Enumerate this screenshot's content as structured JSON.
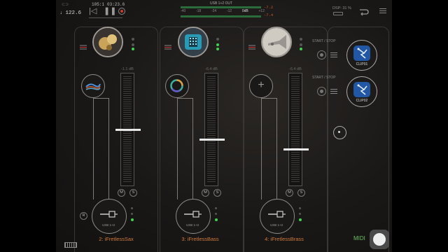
{
  "transport": {
    "position": "105:1",
    "time": "03:23.6",
    "tempo": "122.6",
    "tempo_icon": "metronome-note-icon"
  },
  "output": {
    "label": "USB 1+2 OUT",
    "scale": [
      "-40",
      "-18",
      "-24",
      "-12",
      "0dB",
      "+12"
    ],
    "peak_left": "-7.2",
    "peak_right": "-7.4",
    "readout": "0dB"
  },
  "dsp": {
    "label": "DSP: 31 %"
  },
  "channels": [
    {
      "name": "2: iFretlessSax",
      "db": "-1.1 dB",
      "output": "USB 1+2",
      "instrument": "saxophone",
      "fader_level": 0.5,
      "effect": "waves"
    },
    {
      "name": "3: iFretlessBass",
      "db": "-6.4 dB",
      "output": "USB 1+2",
      "instrument": "bass-app",
      "fader_level": 0.41,
      "effect": "ring"
    },
    {
      "name": "4: iFretlessBrass",
      "db": "-6.4 dB",
      "output": "USB 1+2",
      "instrument": "trumpet",
      "fader_level": 0.32,
      "effect": "add"
    }
  ],
  "buttons": {
    "mute": "M",
    "solo": "S",
    "record": "R"
  },
  "clips": [
    {
      "start_stop": "START / STOP",
      "label": "CLIP01"
    },
    {
      "start_stop": "START / STOP",
      "label": "CLIP02"
    }
  ],
  "midi": {
    "label": "MIDI"
  },
  "colors": {
    "channel_name": "#d07a3a",
    "midi": "#6cc060",
    "led_green": "#3fd24f",
    "record_red": "#d03a2a"
  }
}
